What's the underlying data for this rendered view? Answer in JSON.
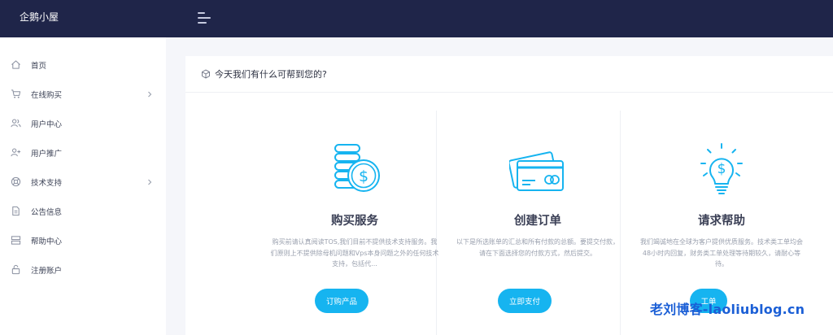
{
  "app": {
    "brand": "企鹅小屋",
    "accent_color": "#16b4f0",
    "topbar_color": "#1f2549"
  },
  "sidebar": {
    "items": [
      {
        "label": "首页",
        "icon": "home-icon",
        "has_submenu": false
      },
      {
        "label": "在线购买",
        "icon": "cart-icon",
        "has_submenu": true
      },
      {
        "label": "用户中心",
        "icon": "users-icon",
        "has_submenu": false
      },
      {
        "label": "用户推广",
        "icon": "user-plus-icon",
        "has_submenu": false
      },
      {
        "label": "技术支持",
        "icon": "support-icon",
        "has_submenu": true
      },
      {
        "label": "公告信息",
        "icon": "document-icon",
        "has_submenu": false
      },
      {
        "label": "帮助中心",
        "icon": "server-icon",
        "has_submenu": false
      },
      {
        "label": "注册账户",
        "icon": "lock-icon",
        "has_submenu": false
      }
    ]
  },
  "panel": {
    "title": "今天我们有什么可帮到您的?",
    "cards": [
      {
        "title": "购买服务",
        "description": "购买前请认真阅读TOS,我们目前不提供技术支持服务。我们原则上不提供除母机问题和Vps本身问题之外的任何技术支持，包括代...",
        "button": "订购产品",
        "icon": "coins-dollar-icon"
      },
      {
        "title": "创建订单",
        "description": "以下是所选账单的汇总和所有付款的总额。要提交付款，请在下面选择您的付款方式，然后提交。",
        "button": "立即支付",
        "icon": "credit-card-icon"
      },
      {
        "title": "请求帮助",
        "description": "我们竭诚地在全球为客户提供优质服务。技术类工单均会48小时内回复，财务类工单处理等待期较久，请耐心等待。",
        "button": "工单",
        "icon": "lightbulb-dollar-icon"
      }
    ]
  },
  "watermark": "老刘博客-laoliublog.cn"
}
